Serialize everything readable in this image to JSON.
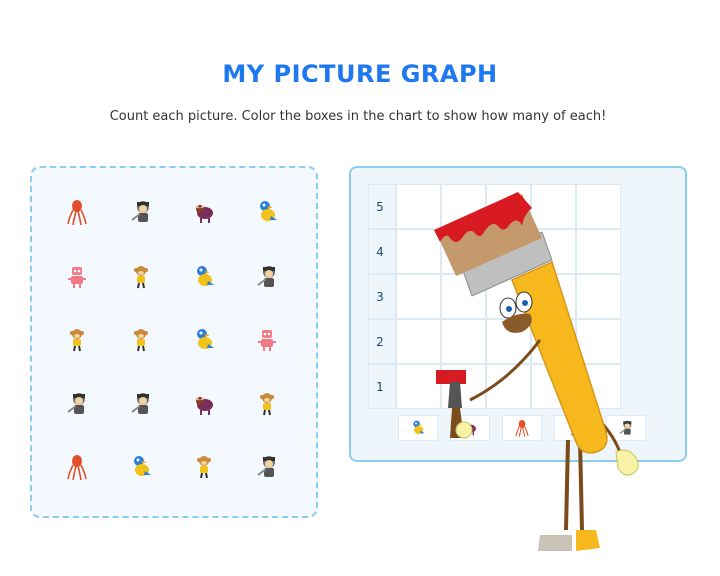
{
  "header": {
    "title": "MY PICTURE GRAPH",
    "subtitle": "Count each picture. Color the boxes in the chart to show how many of each!"
  },
  "picture_grid": [
    [
      "squid-icon",
      "pirate-icon",
      "bull-icon",
      "bird-icon"
    ],
    [
      "robot-icon",
      "monkey-icon",
      "bird-icon",
      "pirate-icon"
    ],
    [
      "monkey-icon",
      "monkey-icon",
      "bird-icon",
      "robot-icon"
    ],
    [
      "pirate-icon",
      "pirate-icon",
      "bull-icon",
      "monkey-icon"
    ],
    [
      "squid-icon",
      "bird-icon",
      "monkey-icon",
      "pirate-icon"
    ]
  ],
  "chart": {
    "y_labels": [
      "5",
      "4",
      "3",
      "2",
      "1"
    ],
    "x_icons": [
      "bird-icon",
      "bull-icon",
      "squid-icon",
      "monkey-icon",
      "pirate-icon"
    ]
  },
  "colors": {
    "title": "#1e78f0",
    "panel_border": "#8ccdee",
    "brush_handle": "#f6b81c",
    "brush_paint": "#d81b22"
  },
  "mascot": "paintbrush-mascot"
}
